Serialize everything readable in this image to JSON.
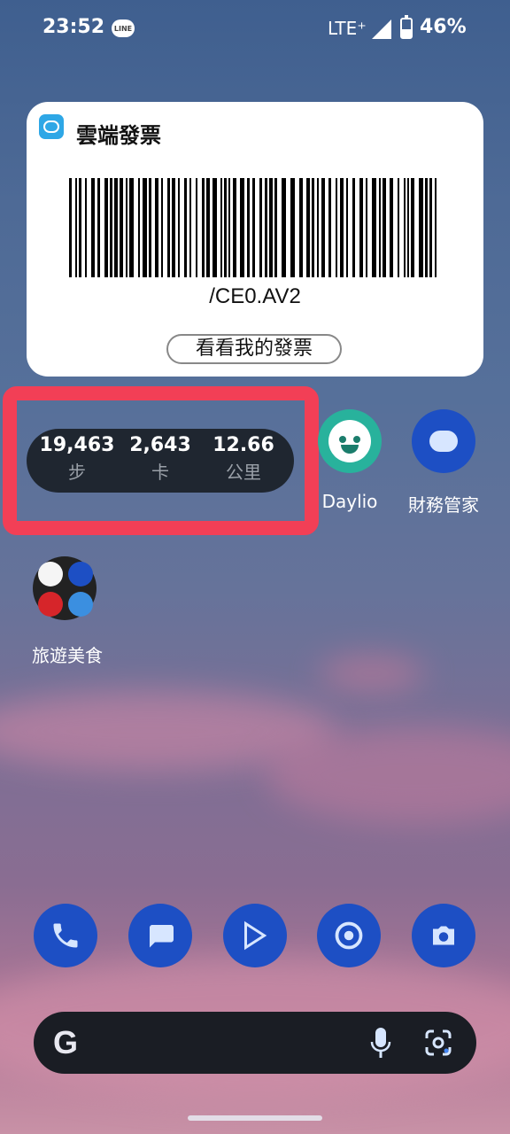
{
  "status_bar": {
    "time": "23:52",
    "line_badge": "LINE",
    "network": "LTE⁺",
    "battery": "46%"
  },
  "invoice_widget": {
    "title": "雲端發票",
    "barcode_text": "/CE0.AV2",
    "button_label": "看看我的發票"
  },
  "fitness_widget": {
    "stats": [
      {
        "value": "19,463",
        "unit": "步"
      },
      {
        "value": "2,643",
        "unit": "卡"
      },
      {
        "value": "12.66",
        "unit": "公里"
      }
    ],
    "highlight_color": "#f23f56"
  },
  "apps": {
    "daylio": "Daylio",
    "finance": "財務管家",
    "folder": "旅遊美食"
  },
  "dock": [
    "phone-icon",
    "messages-icon",
    "play-store-icon",
    "chrome-icon",
    "camera-icon"
  ],
  "search_bar": {
    "logo": "G"
  }
}
